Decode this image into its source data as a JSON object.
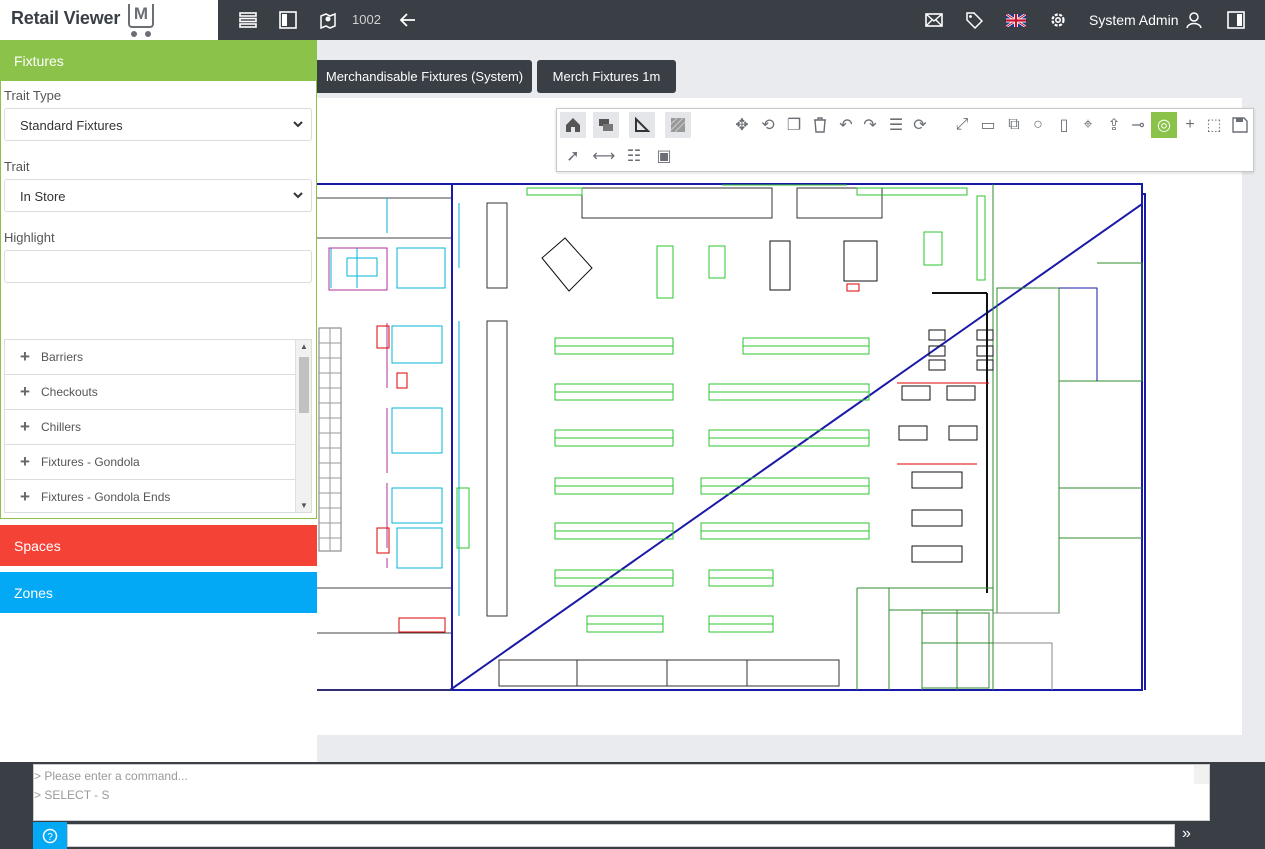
{
  "app": {
    "brand": "Retail Viewer",
    "brand_mark": "M"
  },
  "topbar": {
    "store_number": "1002",
    "user_name": "System Admin",
    "icons": [
      "list-icon",
      "sidebar-toggle-icon",
      "map-icon",
      "back-arrow-icon",
      "mail-icon",
      "tag-icon",
      "uk-flag-icon",
      "gear-icon",
      "user-icon",
      "panel-icon"
    ]
  },
  "sidebar": {
    "fixtures_header": "Fixtures",
    "trait_type_label": "Trait Type",
    "trait_type_value": "Standard Fixtures",
    "trait_label": "Trait",
    "trait_value": "In Store",
    "highlight_label": "Highlight",
    "highlight_value": "",
    "items": [
      {
        "label": "Barriers"
      },
      {
        "label": "Checkouts"
      },
      {
        "label": "Chillers"
      },
      {
        "label": "Fixtures - Gondola"
      },
      {
        "label": "Fixtures - Gondola Ends"
      }
    ],
    "spaces_header": "Spaces",
    "zones_header": "Zones"
  },
  "tabs": [
    {
      "label": "Merchandisable Fixtures (System)"
    },
    {
      "label": "Merch Fixtures 1m"
    }
  ],
  "toolbar": {
    "row1": [
      "home-icon",
      "layers-icon",
      "measure-icon",
      "hatch-icon",
      "move-icon",
      "rotate-icon",
      "copy-icon",
      "delete-icon",
      "undo-icon",
      "redo-icon",
      "list-icon",
      "refresh-icon",
      "fit-icon",
      "monitor-icon",
      "windows-icon",
      "circle-icon",
      "rectangle-icon",
      "target-icon",
      "export-icon",
      "line-icon",
      "snap-icon",
      "crosshair-icon",
      "grid-icon",
      "save-icon"
    ],
    "row2": [
      "pointer-icon",
      "dimension-icon",
      "numbered-list-icon",
      "screen-icon"
    ],
    "active": "snap-icon"
  },
  "command": {
    "placeholder_line": "> Please enter a command...",
    "history": [
      "> SELECT - S"
    ],
    "input_value": ""
  },
  "colors": {
    "green": "#8bc34a",
    "red": "#f44336",
    "blue": "#03a9f4",
    "dark": "#3a3f46"
  }
}
